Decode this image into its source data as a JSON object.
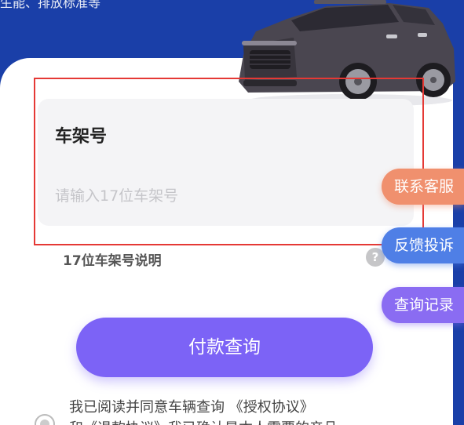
{
  "header": {
    "partial_text": "生能、排放标准等"
  },
  "vin_field": {
    "title": "车架号",
    "placeholder": "请输入17位车架号",
    "value": ""
  },
  "vin_help": {
    "label": "17位车架号说明",
    "icon_glyph": "?"
  },
  "floating_actions": {
    "contact_service": "联系客服",
    "feedback_complaint": "反馈投诉",
    "query_records": "查询记录"
  },
  "pay_button": {
    "label": "付款查询"
  },
  "agreement": {
    "line1": "我已阅读并同意车辆查询 《授权协议》",
    "line2": "和《退款协议》我已确认是本人需要的产品"
  },
  "colors": {
    "brand_blue": "#1a3fa8",
    "primary_purple": "#7c63f6",
    "service_orange": "#f0906e",
    "feedback_blue": "#4f7fe6",
    "records_purple": "#8a6cf2",
    "highlight_red": "#e53935"
  },
  "icons": {
    "car_image": "suv-car-image",
    "help": "question-circle-icon"
  }
}
